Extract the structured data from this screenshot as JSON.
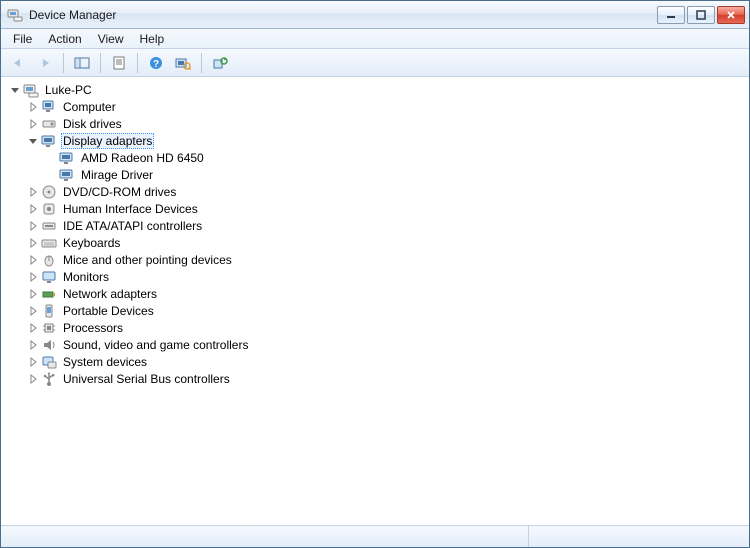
{
  "window": {
    "title": "Device Manager"
  },
  "menu": {
    "file": "File",
    "action": "Action",
    "view": "View",
    "help": "Help"
  },
  "tree": {
    "root": {
      "label": "Luke-PC"
    },
    "computer": {
      "label": "Computer"
    },
    "disk_drives": {
      "label": "Disk drives"
    },
    "display_adapters": {
      "label": "Display adapters"
    },
    "display_children": [
      {
        "label": "AMD Radeon HD 6450"
      },
      {
        "label": "Mirage Driver"
      }
    ],
    "dvd": {
      "label": "DVD/CD-ROM drives"
    },
    "hid": {
      "label": "Human Interface Devices"
    },
    "ide": {
      "label": "IDE ATA/ATAPI controllers"
    },
    "keyboards": {
      "label": "Keyboards"
    },
    "mice": {
      "label": "Mice and other pointing devices"
    },
    "monitors": {
      "label": "Monitors"
    },
    "network": {
      "label": "Network adapters"
    },
    "portable": {
      "label": "Portable Devices"
    },
    "processors": {
      "label": "Processors"
    },
    "sound": {
      "label": "Sound, video and game controllers"
    },
    "system": {
      "label": "System devices"
    },
    "usb": {
      "label": "Universal Serial Bus controllers"
    }
  }
}
